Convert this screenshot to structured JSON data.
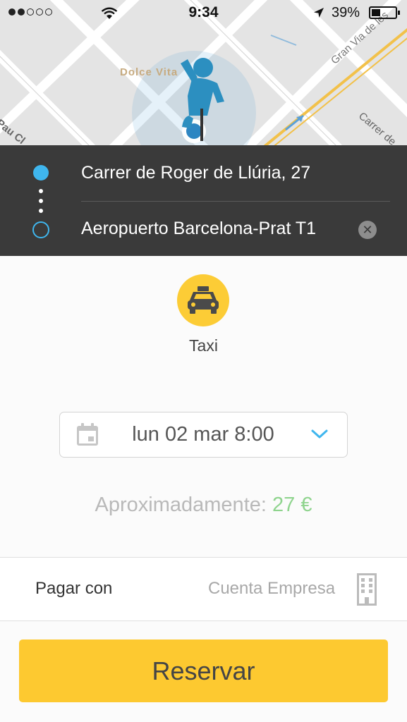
{
  "status_bar": {
    "signal_dots": [
      true,
      true,
      false,
      false,
      false
    ],
    "wifi_icon": "wifi-icon",
    "time": "9:34",
    "location_icon": "location-arrow-icon",
    "battery_percent": "39%",
    "battery_level": 0.39
  },
  "map": {
    "labels": [
      "Dolce Vita",
      "Gran Via de les",
      "Pau Cl",
      "Carrer de"
    ],
    "pin_icon": "street-view-person-icon"
  },
  "route": {
    "origin": "Carrer de Roger de Llúria, 27",
    "destination": "Aeropuerto Barcelona-Prat T1",
    "clear_icon": "close-icon",
    "clear_glyph": "✕"
  },
  "service": {
    "label": "Taxi",
    "icon": "taxi-icon"
  },
  "schedule": {
    "datetime": "lun 02 mar 8:00",
    "calendar_icon": "calendar-icon",
    "dropdown_icon": "chevron-down-icon"
  },
  "estimate": {
    "label": "Aproximadamente:",
    "price": "27 €"
  },
  "payment": {
    "label": "Pagar con",
    "value": "Cuenta Empresa",
    "icon": "building-icon"
  },
  "actions": {
    "reserve_label": "Reservar"
  },
  "colors": {
    "accent_blue": "#3fb6ee",
    "taxi_yellow": "#fccc36",
    "button_yellow": "#fdc930",
    "price_green": "#8fd48e",
    "panel_dark": "#3a3a3a"
  }
}
